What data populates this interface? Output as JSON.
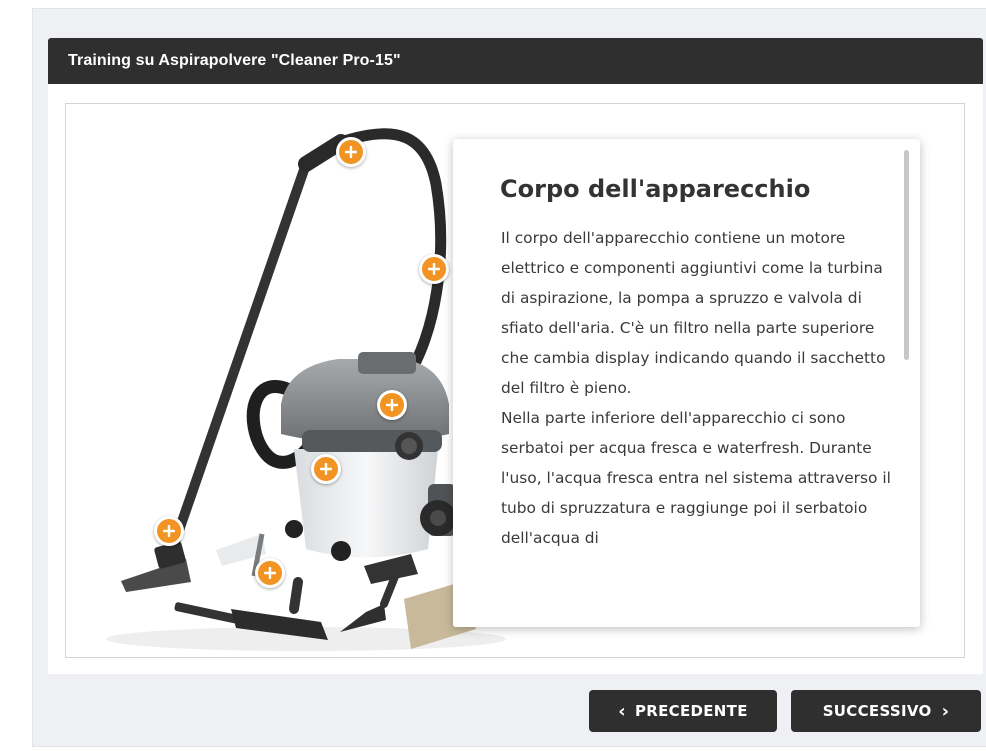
{
  "header": {
    "title": "Training su Aspirapolvere \"Cleaner Pro-15\""
  },
  "info_card": {
    "title": "Corpo dell'apparecchio",
    "paragraphs": [
      "Il corpo dell'apparecchio contiene un motore elettrico e componenti aggiuntivi come la turbina di aspirazione, la pompa a spruzzo e valvola di sfiato dell'aria. C'è un filtro nella parte superiore che cambia display indicando quando il sacchetto del filtro è pieno.",
      "Nella parte inferiore dell'apparecchio ci sono serbatoi per acqua fresca e waterfresh. Durante l'uso, l'acqua fresca entra nel sistema attraverso il tubo di spruzzatura e raggiunge poi il serbatoio dell'acqua di"
    ]
  },
  "hotspot_icon": "plus-icon",
  "navigation": {
    "prev_label": "PRECEDENTE",
    "next_label": "SUCCESSIVO",
    "prev_icon": "chevron-left-icon",
    "next_icon": "chevron-right-icon"
  },
  "colors": {
    "header_bg": "#2f2f2f",
    "hotspot": "#f29423",
    "button_bg": "#2f2f2f",
    "panel_bg": "#eef0f4"
  }
}
